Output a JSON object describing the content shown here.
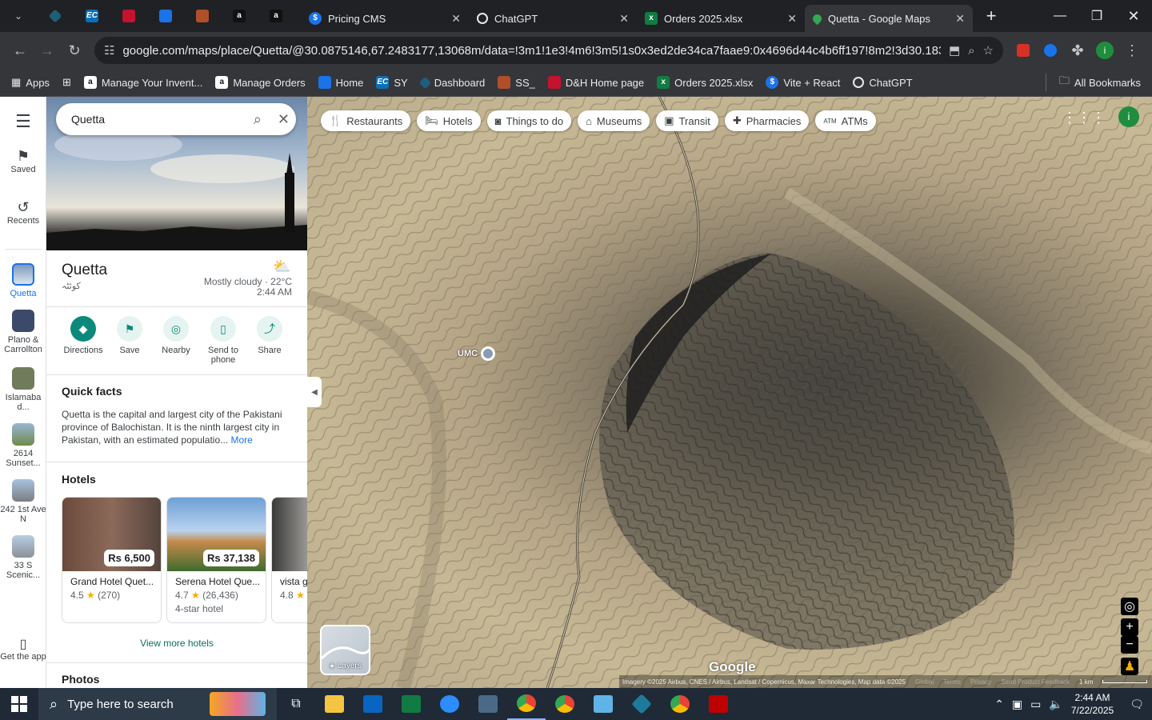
{
  "tabs": {
    "pinned": [
      {
        "icon": "menu-chevron-icon"
      },
      {
        "icon": "diamond-app-icon"
      },
      {
        "icon": "ec-icon",
        "text": "EC"
      },
      {
        "icon": "dh-icon"
      },
      {
        "icon": "g-icon"
      },
      {
        "icon": "ss-icon"
      },
      {
        "icon": "amazon-icon",
        "text": "a"
      },
      {
        "icon": "amazon-icon",
        "text": "a"
      }
    ],
    "items": [
      {
        "label": "Pricing CMS",
        "icon": "dollar-icon"
      },
      {
        "label": "ChatGPT",
        "icon": "chatgpt-icon"
      },
      {
        "label": "Orders 2025.xlsx",
        "icon": "excel-icon"
      },
      {
        "label": "Quetta - Google Maps",
        "icon": "maps-pin-icon"
      }
    ]
  },
  "url": "google.com/maps/place/Quetta/@30.0875146,67.2483177,13068m/data=!3m1!1e3!4m6!3m5!1s0x3ed2de34ca7faae9:0x4696d44c4b6ff197!8m2!3d30.183...",
  "bookmarks": [
    {
      "label": "Apps",
      "icon": "apps-grid-icon"
    },
    {
      "label": "Manage Your Invent...",
      "icon": "amazon-icon"
    },
    {
      "label": "Manage Orders",
      "icon": "amazon-icon"
    },
    {
      "label": "Home",
      "icon": "g-icon"
    },
    {
      "label": "SY",
      "icon": "ec-icon"
    },
    {
      "label": "Dashboard",
      "icon": "diamond-app-icon"
    },
    {
      "label": "SS_",
      "icon": "ss-icon"
    },
    {
      "label": "D&H Home page",
      "icon": "dh-icon"
    },
    {
      "label": "Orders 2025.xlsx",
      "icon": "excel-icon"
    },
    {
      "label": "Vite + React",
      "icon": "dollar-icon"
    },
    {
      "label": "ChatGPT",
      "icon": "chatgpt-icon"
    },
    {
      "label": "All Bookmarks",
      "icon": "folder-icon"
    }
  ],
  "rail": {
    "saved": "Saved",
    "recents": "Recents",
    "places": [
      {
        "label": "Quetta"
      },
      {
        "label": "Plano & Carrollton"
      },
      {
        "label": "Islamaba d..."
      },
      {
        "label": "2614 Sunset..."
      },
      {
        "label": "242 1st Ave N"
      },
      {
        "label": "33 S Scenic..."
      }
    ],
    "get_app": "Get the app"
  },
  "panel": {
    "search_value": "Quetta",
    "place_name": "Quetta",
    "place_native": "کوئٹہ",
    "weather": "Mostly cloudy · 22°C",
    "time": "2:44 AM",
    "actions": [
      {
        "label": "Directions",
        "icon": "directions-icon"
      },
      {
        "label": "Save",
        "icon": "bookmark-icon"
      },
      {
        "label": "Nearby",
        "icon": "nearby-icon"
      },
      {
        "label": "Send to phone",
        "icon": "phone-icon"
      },
      {
        "label": "Share",
        "icon": "share-icon"
      }
    ],
    "quick_facts_title": "Quick facts",
    "quick_facts_text": "Quetta is the capital and largest city of the Pakistani province of Balochistan. It is the ninth largest city in Pakistan, with an estimated populatio...",
    "more": "More",
    "hotels_title": "Hotels",
    "hotels": [
      {
        "price": "Rs 6,500",
        "name": "Grand Hotel Quet...",
        "rating": "4.5",
        "reviews": "(270)",
        "type": ""
      },
      {
        "price": "Rs 37,138",
        "name": "Serena Hotel Que...",
        "rating": "4.7",
        "reviews": "(26,436)",
        "type": "4-star hotel"
      },
      {
        "price": "",
        "name": "vista g",
        "rating": "4.8",
        "reviews": "",
        "type": ""
      }
    ],
    "view_more": "View more hotels",
    "photos_title": "Photos"
  },
  "map": {
    "chips": [
      {
        "label": "Restaurants",
        "icon": "fork-knife-icon"
      },
      {
        "label": "Hotels",
        "icon": "bed-icon"
      },
      {
        "label": "Things to do",
        "icon": "camera-icon"
      },
      {
        "label": "Museums",
        "icon": "museum-icon"
      },
      {
        "label": "Transit",
        "icon": "bus-icon"
      },
      {
        "label": "Pharmacies",
        "icon": "pharmacy-icon"
      },
      {
        "label": "ATMs",
        "icon": "atm-icon"
      }
    ],
    "pin_label": "UMC",
    "layers": "Layers",
    "logo": "Google",
    "attribution": "Imagery ©2025 Airbus, CNES / Airbus, Landsat / Copernicus, Maxar Technologies, Map data ©2025",
    "footer_links": [
      "Global",
      "Terms",
      "Privacy",
      "Send Product Feedback"
    ],
    "scale": "1 km",
    "profile_initial": "i"
  },
  "taskbar": {
    "search_placeholder": "Type here to search",
    "time": "2:44 AM",
    "date": "7/22/2025"
  },
  "colors": {
    "teal": "#0b8a7b",
    "maps_link": "#1a73e8",
    "profile_green": "#1e8e3e"
  }
}
